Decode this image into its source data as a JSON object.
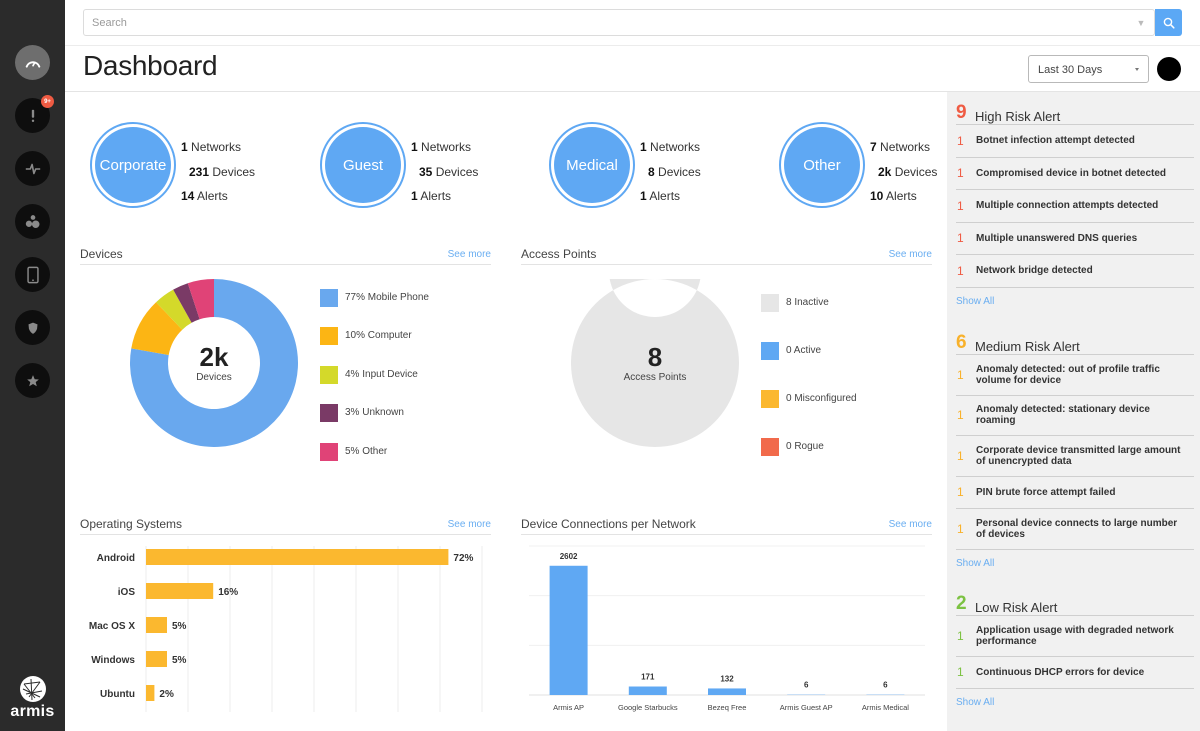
{
  "app": {
    "brand": "armis"
  },
  "colors": {
    "accent": "#5fa8f3",
    "high": "#ef5b43",
    "medium": "#f8b12b",
    "low": "#7cc242",
    "link": "#6aaef1"
  },
  "sidebar": {
    "items": [
      {
        "name": "dashboard",
        "icon": "gauge-icon",
        "active": true
      },
      {
        "name": "alerts",
        "icon": "exclamation-icon",
        "badge": "9+"
      },
      {
        "name": "activity",
        "icon": "pulse-icon"
      },
      {
        "name": "networks",
        "icon": "bubbles-icon"
      },
      {
        "name": "devices",
        "icon": "tablet-icon"
      },
      {
        "name": "policies",
        "icon": "shield-icon"
      },
      {
        "name": "favorites",
        "icon": "star-icon"
      }
    ],
    "logo_text": "armis"
  },
  "search": {
    "placeholder": "Search",
    "value": ""
  },
  "header": {
    "title": "Dashboard",
    "range_label": "Last 30 Days"
  },
  "networks": [
    {
      "name": "Corporate",
      "networks": "1",
      "networks_label": "Networks",
      "devices": "231",
      "devices_label": "Devices",
      "alerts": "14",
      "alerts_label": "Alerts"
    },
    {
      "name": "Guest",
      "networks": "1",
      "networks_label": "Networks",
      "devices": "35",
      "devices_label": "Devices",
      "alerts": "1",
      "alerts_label": "Alerts"
    },
    {
      "name": "Medical",
      "networks": "1",
      "networks_label": "Networks",
      "devices": "8",
      "devices_label": "Devices",
      "alerts": "1",
      "alerts_label": "Alerts"
    },
    {
      "name": "Other",
      "networks": "7",
      "networks_label": "Networks",
      "devices": "2k",
      "devices_label": "Devices",
      "alerts": "10",
      "alerts_label": "Alerts"
    }
  ],
  "panels": {
    "devices": {
      "title": "Devices",
      "see_more": "See more",
      "center_value": "2k",
      "center_label": "Devices"
    },
    "access_points": {
      "title": "Access Points",
      "see_more": "See more",
      "center_value": "8",
      "center_label": "Access Points"
    },
    "os": {
      "title": "Operating Systems",
      "see_more": "See more"
    },
    "connections": {
      "title": "Device Connections per Network",
      "see_more": "See more"
    }
  },
  "chart_data": [
    {
      "type": "pie",
      "title": "Devices",
      "donut": true,
      "categories": [
        "Mobile Phone",
        "Computer",
        "Input Device",
        "Unknown",
        "Other"
      ],
      "values": [
        77,
        10,
        4,
        3,
        5
      ],
      "labels": [
        "77% Mobile Phone",
        "10% Computer",
        "4% Input Device",
        "3% Unknown",
        "5% Other"
      ],
      "colors": [
        "#69a8ee",
        "#fcb514",
        "#d4d92a",
        "#7a3a66",
        "#e04377"
      ],
      "legend": "right"
    },
    {
      "type": "pie",
      "title": "Access Points",
      "donut": true,
      "categories": [
        "Inactive",
        "Active",
        "Misconfigured",
        "Rogue"
      ],
      "values": [
        8,
        0,
        0,
        0
      ],
      "labels": [
        "8 Inactive",
        "0 Active",
        "0 Misconfigured",
        "0 Rogue"
      ],
      "colors": [
        "#e6e6e6",
        "#5fa8f3",
        "#fbb82f",
        "#f16a4b"
      ],
      "legend": "right"
    },
    {
      "type": "bar",
      "orientation": "horizontal",
      "title": "Operating Systems",
      "categories": [
        "Android",
        "iOS",
        "Mac OS X",
        "Windows",
        "Ubuntu"
      ],
      "values": [
        72,
        16,
        5,
        5,
        2
      ],
      "value_labels": [
        "72%",
        "16%",
        "5%",
        "5%",
        "2%"
      ],
      "xlim": [
        0,
        80
      ],
      "grid": true,
      "color": "#fbb82f"
    },
    {
      "type": "bar",
      "title": "Device Connections per Network",
      "categories": [
        "Armis AP",
        "Google Starbucks",
        "Bezeq Free",
        "Armis Guest AP",
        "Armis Medical"
      ],
      "values": [
        2602,
        171,
        132,
        6,
        6
      ],
      "value_labels": [
        "2602",
        "171",
        "132",
        "6",
        "6"
      ],
      "ylim": [
        0,
        3000
      ],
      "grid": true,
      "color": "#5fa8f3"
    }
  ],
  "alerts": {
    "high": {
      "count": "9",
      "title": "High Risk Alert",
      "show_all": "Show All",
      "items": [
        {
          "count": "1",
          "text": "Botnet infection attempt detected"
        },
        {
          "count": "1",
          "text": "Compromised device in botnet detected"
        },
        {
          "count": "1",
          "text": "Multiple connection attempts detected"
        },
        {
          "count": "1",
          "text": "Multiple unanswered DNS queries"
        },
        {
          "count": "1",
          "text": "Network bridge detected"
        }
      ]
    },
    "medium": {
      "count": "6",
      "title": "Medium Risk Alert",
      "show_all": "Show All",
      "items": [
        {
          "count": "1",
          "text": "Anomaly detected: out of profile traffic volume for device"
        },
        {
          "count": "1",
          "text": "Anomaly detected: stationary device roaming"
        },
        {
          "count": "1",
          "text": "Corporate device transmitted large amount of unencrypted data"
        },
        {
          "count": "1",
          "text": "PIN brute force attempt failed"
        },
        {
          "count": "1",
          "text": "Personal device connects to large number of devices"
        }
      ]
    },
    "low": {
      "count": "2",
      "title": "Low Risk Alert",
      "show_all": "Show All",
      "items": [
        {
          "count": "1",
          "text": "Application usage with degraded network performance"
        },
        {
          "count": "1",
          "text": "Continuous DHCP errors for device"
        }
      ]
    }
  }
}
